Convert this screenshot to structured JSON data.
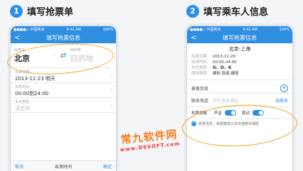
{
  "steps": [
    {
      "num": "1",
      "title": "填写抢票单"
    },
    {
      "num": "2",
      "title": "填写乘车人信息"
    }
  ],
  "phone1": {
    "status": {
      "carrier": "●●●●○ 中国移动",
      "time": "9:42 AM",
      "battery": "100%"
    },
    "nav": {
      "title": "填写抢票信息",
      "back": "<"
    },
    "from": {
      "label": "出发站",
      "value": "北京"
    },
    "to": {
      "label": "目的地",
      "placeholder": "目的地"
    },
    "swap_icon": "⇄",
    "rows": [
      {
        "label": "出发日期",
        "value": "2013-11-23 明天"
      },
      {
        "label": "出发时间",
        "value": "00:00到24:00"
      },
      {
        "label": "车次类型",
        "value": "请选择"
      }
    ],
    "bottom": {
      "cancel": "取消",
      "middle": "出发时间",
      "ok": "确定"
    }
  },
  "phone2": {
    "status": {
      "carrier": "●●●●○ 中国移动",
      "time": "9:42 AM",
      "battery": "100%"
    },
    "nav": {
      "title": "填写抢票信息",
      "back": "<"
    },
    "route": "北京-上海",
    "details": [
      {
        "k": "出发日期",
        "v": "2013-11-20"
      },
      {
        "k": "出发时间",
        "v": "00:00-24:00"
      },
      {
        "k": "车次类型",
        "v": "G、D、K"
      },
      {
        "k": "席别类型",
        "v": "硬卧,软座,硬座"
      }
    ],
    "passenger_label": "乘客信息",
    "contact": {
      "label": "联系电话",
      "placeholder": "用于接收通知",
      "link": "选联系"
    },
    "reminder": {
      "label": "抢票提醒",
      "sound": "声音",
      "vibrate": "震动"
    },
    "agree_text": "抢票当天，免费赠送公共交通意外保险"
  },
  "watermark": {
    "big": "常九软件网",
    "small": "www.D9SOFT.com"
  },
  "colors": {
    "accent": "#2e8fe0",
    "highlight": "#f3a31a",
    "watermark": "#f07b1d"
  }
}
